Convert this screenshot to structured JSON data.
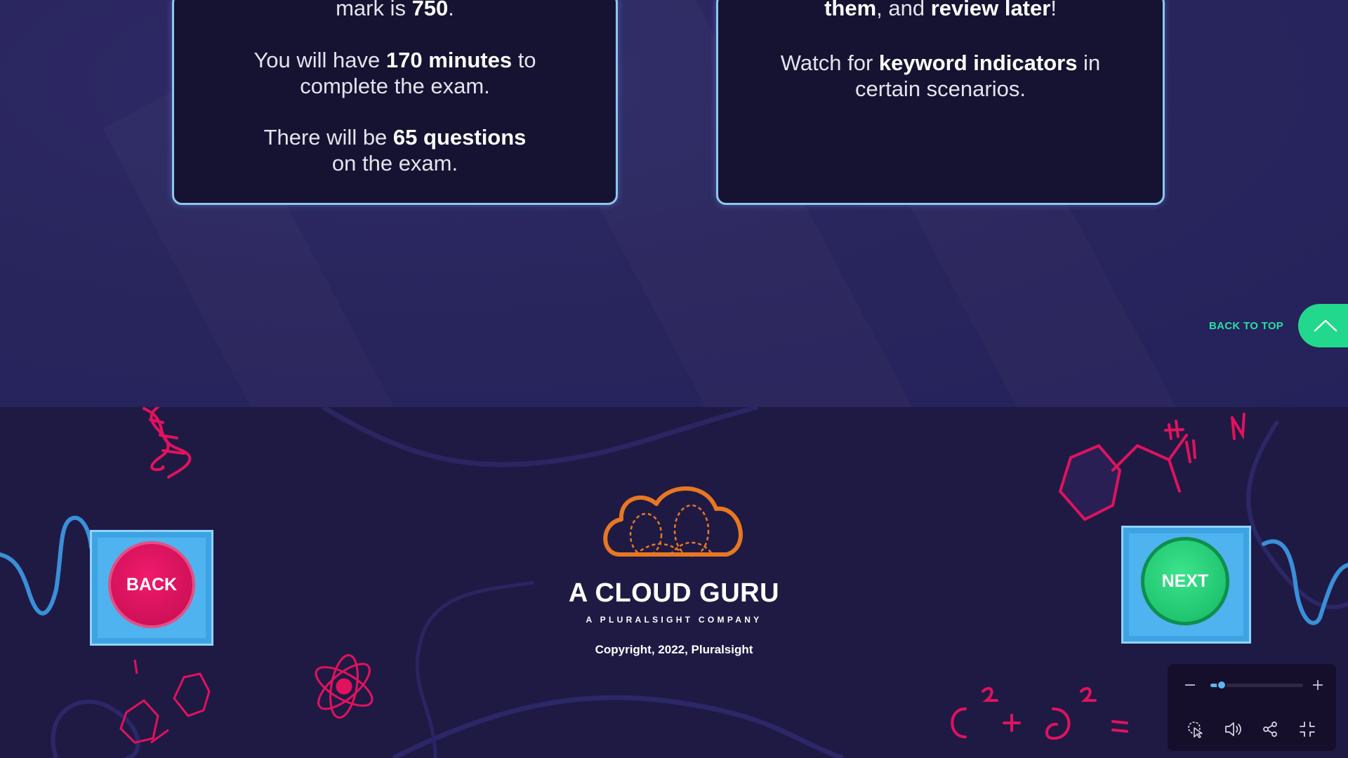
{
  "cards": {
    "left": {
      "line0_pre": "mark is ",
      "line0_bold": "750",
      "line0_post": ".",
      "p1_pre": "You will have ",
      "p1_bold": "170 minutes",
      "p1_post": " to",
      "p1_line2": "complete the exam.",
      "p2_pre": "There will be ",
      "p2_bold": "65 questions",
      "p2_line2": "on the exam."
    },
    "right": {
      "line0_bold1": "them",
      "line0_mid": ", and ",
      "line0_bold2": "review later",
      "line0_post": "!",
      "p1_pre": "Watch for ",
      "p1_bold": "keyword indicators",
      "p1_post": " in",
      "p1_line2": "certain scenarios."
    }
  },
  "back_to_top": {
    "label": "BACK TO TOP"
  },
  "footer": {
    "brand_name": "A CLOUD GURU",
    "brand_sub": "A PLURALSIGHT COMPANY",
    "copyright": "Copyright, 2022, Pluralsight",
    "back_label": "BACK",
    "next_label": "NEXT"
  },
  "controls": {
    "zoom_level": 0.12,
    "icons": [
      "zoom-out-icon",
      "zoom-in-icon",
      "pointer-icon",
      "volume-icon",
      "share-icon",
      "exit-fullscreen-icon"
    ]
  },
  "colors": {
    "card_border": "#8fc6f0",
    "back_to_top": "#22d88c",
    "back_button": "#e0165f",
    "next_button": "#22cc74",
    "logo_orange": "#e87722",
    "doodle_pink": "#e0125e"
  }
}
